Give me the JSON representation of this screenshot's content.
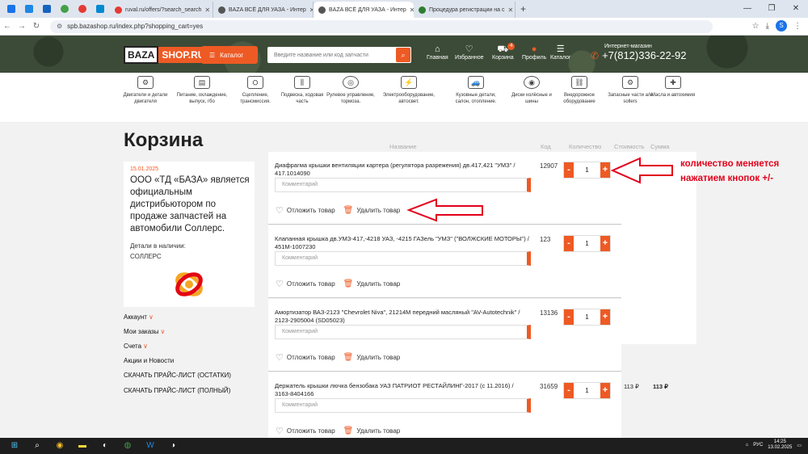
{
  "browser": {
    "tabs": [
      {
        "title": "ruval.ru/offers/?search_search",
        "fav": "#e53935",
        "active": false
      },
      {
        "title": "BAZA ВСЁ ДЛЯ УАЗА - Интер",
        "fav": "#555",
        "active": false
      },
      {
        "title": "BAZA ВСЁ ДЛЯ УАЗА - Интер",
        "fav": "#555",
        "active": true
      },
      {
        "title": "Процедура регистрации на с",
        "fav": "#2e7d32",
        "active": false
      }
    ],
    "url": "spb.bazashop.ru/index.php?shopping_cart=yes",
    "profile_initial": "S"
  },
  "header": {
    "logo_left": "BAZA",
    "logo_right": "SHOP.RU",
    "catalog_button": "Каталог",
    "search_placeholder": "Введите название или код запчасти",
    "nav": [
      {
        "label": "Главная",
        "icon": "home-icon",
        "glyph": "⌂"
      },
      {
        "label": "Избранное",
        "icon": "heart-icon",
        "glyph": "♡"
      },
      {
        "label": "Корзина",
        "icon": "cart-icon",
        "glyph": "🛒",
        "badge": "4"
      },
      {
        "label": "Профиль",
        "icon": "user-icon",
        "glyph": "👤"
      },
      {
        "label": "Каталог",
        "icon": "menu-icon",
        "glyph": "☰"
      }
    ],
    "shop_label": "Интернет-магазин",
    "phone": "+7(812)336-22-92"
  },
  "categories": [
    "Двигатели и детали двигателя",
    "Питание, охлаждение, выпуск, гбо",
    "Сцепление, трансмиссия.",
    "Подвеска, ходовая часть",
    "Рулевое управление, тормоза.",
    "Электрооборудование, автосвет.",
    "Кузовные детали, салон, отопление.",
    "Диски колёсные и шины",
    "Внедорожное оборудование",
    "Запасные части а/м sollers",
    "Масла и автохимия"
  ],
  "page": {
    "title": "Корзина",
    "info_date": "15.01.2025",
    "info_text": "ООО «ТД «БАЗА» является официальным дистрибьютором по продаже запчастей на автомобили Соллерс.",
    "available_label": "Детали в наличии:",
    "brand": "СОЛЛЕРС"
  },
  "sidebar": {
    "account": "Аккаунт",
    "orders": "Мои заказы",
    "invoices": "Счета",
    "promos": "Акции и Новости",
    "price_stock": "СКАЧАТЬ ПРАЙС-ЛИСТ (ОСТАТКИ)",
    "price_full": "СКАЧАТЬ ПРАЙС-ЛИСТ (ПОЛНЫЙ)"
  },
  "columns": {
    "name": "Название",
    "code": "Код",
    "qty": "Количество",
    "price": "Стоимость",
    "sum": "Сумма"
  },
  "cart": {
    "comment_placeholder": "Комментарий",
    "postpone": "Отложить товар",
    "delete": "Удалить товар",
    "minus": "-",
    "plus": "+",
    "items": [
      {
        "name": "Диафрагма крышки вентиляции картера (регулятора разрежения) дв.417,421 \"УМЗ\" / 417.1014090",
        "code": "12907",
        "qty": "1",
        "price": "",
        "sum": ""
      },
      {
        "name": "Клапанная крышка дв.УМЗ-417,-4218 УАЗ, -4215 ГАЗель \"УМЗ\" (\"ВОЛЖСКИЕ МОТОРЫ\") / 451М-1007230",
        "code": "123",
        "qty": "1",
        "price": "",
        "sum": ""
      },
      {
        "name": "Амортизатор ВАЗ-2123 \"Chevrolet Niva\", 21214М передний масляный \"AV-Autotechnik\" / 2123-2905004 (SD05023)",
        "code": "13136",
        "qty": "1",
        "price": "",
        "sum": ""
      },
      {
        "name": "Держатель крышки лючка бензобака УАЗ ПАТРИОТ РЕСТАЙЛИНГ-2017 (с 11.2016) / 3163-8404166",
        "code": "31659",
        "qty": "1",
        "price": "113 ₽",
        "sum": "113 ₽"
      }
    ]
  },
  "annotation": {
    "text": "количество меняется нажатием кнопок +/-",
    "color": "#e3001b"
  },
  "taskbar": {
    "lang": "РУС",
    "time": "14:25",
    "date": "13.02.2025"
  },
  "colors": {
    "accent": "#ee5a24",
    "header_bg": "#3c4b37"
  }
}
